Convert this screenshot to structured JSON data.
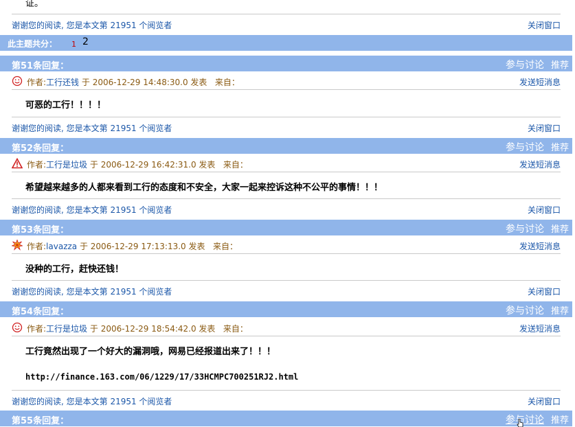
{
  "top_text": "证。",
  "footer_text": "谢谢您的阅读, 您是本文第 21951 个阅览者",
  "close_label": "关闭窗口",
  "pages": {
    "label": "此主题共分：",
    "p1": "1",
    "p2": "2"
  },
  "discuss_label": "参与讨论",
  "recommend_label": "推荐",
  "sms_label": "发送短消息",
  "author_prefix": "作者:",
  "from_label": "来自：",
  "posts": [
    {
      "title": "第51条回复：",
      "author": "工行还钱",
      "when": "于 2006-12-29 14:48:30.0 发表",
      "body": "可恶的工行！！！！"
    },
    {
      "title": "第52条回复：",
      "author": "工行是垃圾",
      "when": "于 2006-12-29 16:42:31.0 发表",
      "body": "希望越来越多的人都来看到工行的态度和不安全，大家一起来控诉这种不公平的事情！！！"
    },
    {
      "title": "第53条回复：",
      "author": "lavazza",
      "when": "于 2006-12-29 17:13:13.0 发表",
      "body": "没种的工行，赶快还钱！"
    },
    {
      "title": "第54条回复：",
      "author": "工行是垃圾",
      "when": "于 2006-12-29 18:54:42.0 发表",
      "body": "工行竟然出现了一个好大的漏洞哦，网易已经报道出来了！！！",
      "url": "http://finance.163.com/06/1229/17/33HCMPC700251RJ2.html"
    },
    {
      "title": "第55条回复："
    }
  ]
}
